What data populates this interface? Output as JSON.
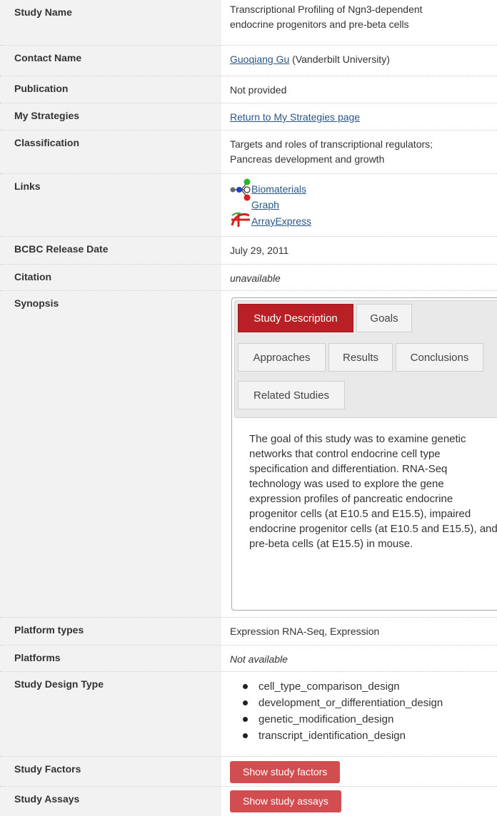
{
  "rows": {
    "study_name": {
      "label": "Study Name",
      "value": "Transcriptional Profiling of Ngn3-dependent endocrine progenitors and pre-beta cells"
    },
    "contact_name": {
      "label": "Contact Name",
      "link": "Guoqiang Gu",
      "suffix": " (Vanderbilt University)"
    },
    "publication": {
      "label": "Publication",
      "value": "Not provided"
    },
    "my_strategies": {
      "label": "My Strategies",
      "link": "Return to My Strategies page"
    },
    "classification": {
      "label": "Classification",
      "line1": "Targets and roles of transcriptional regulators;",
      "line2": "Pancreas development and growth"
    },
    "links": {
      "label": "Links",
      "biomaterials": "Biomaterials Graph",
      "arrayexpress": "ArrayExpress"
    },
    "release_date": {
      "label": "BCBC Release Date",
      "value": "July 29, 2011"
    },
    "citation": {
      "label": "Citation",
      "value": "unavailable"
    },
    "synopsis": {
      "label": "Synopsis",
      "tabs": [
        "Study Description",
        "Goals",
        "Approaches",
        "Results",
        "Conclusions",
        "Related Studies"
      ],
      "active_tab": "Study Description",
      "text": "The goal of this study was to examine genetic networks that control endocrine cell type specification and differentiation. RNA-Seq technology was used to explore the gene expression profiles of pancreatic endocrine progenitor cells (at E10.5 and E15.5), impaired endocrine progenitor cells (at E10.5 and E15.5), and pre-beta cells (at E15.5) in mouse."
    },
    "platform_types": {
      "label": "Platform types",
      "value": "Expression RNA-Seq, Expression"
    },
    "platforms": {
      "label": "Platforms",
      "value": "Not available"
    },
    "design_type": {
      "label": "Study Design Type",
      "items": [
        "cell_type_comparison_design",
        "development_or_differentiation_design",
        "genetic_modification_design",
        "transcript_identification_design"
      ]
    },
    "study_factors": {
      "label": "Study Factors",
      "button": "Show study factors"
    },
    "study_assays": {
      "label": "Study Assays",
      "button": "Show study assays"
    }
  },
  "colors": {
    "accent_red": "#b82025",
    "button_red": "#d14d4f",
    "link_blue": "#2a5686",
    "label_bg": "#f2f2f2"
  },
  "icons": {
    "biomaterials": "network-graph-icon",
    "arrayexpress": "arrayexpress-logo-icon"
  }
}
